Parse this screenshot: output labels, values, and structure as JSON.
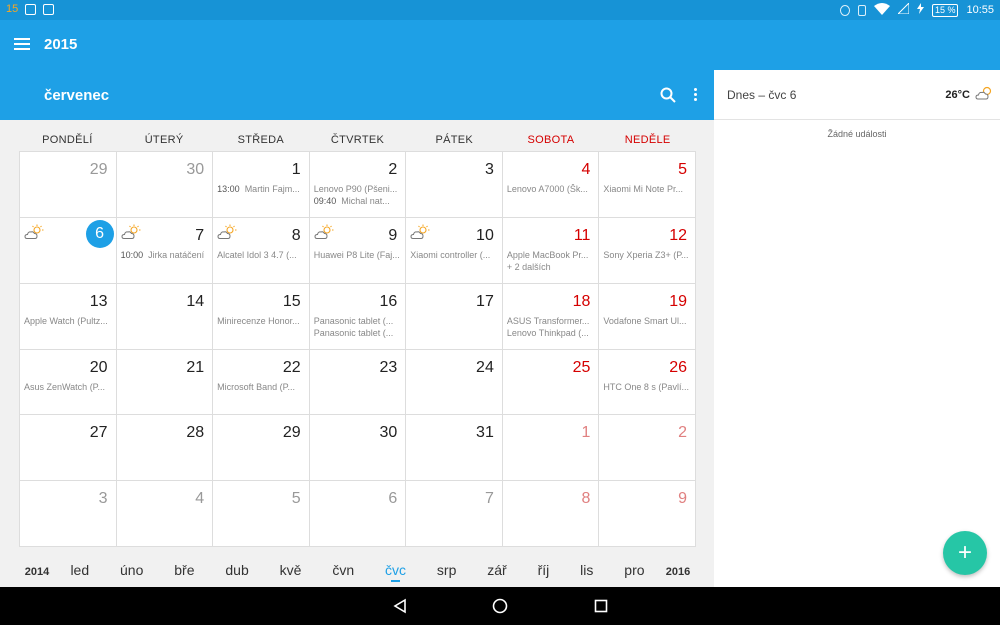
{
  "status_bar": {
    "left_number": "15",
    "battery": "15 %",
    "time": "10:55"
  },
  "app_bar": {
    "year": "2015"
  },
  "sub_bar": {
    "month": "červenec"
  },
  "weekdays": [
    "PONDĚLÍ",
    "ÚTERÝ",
    "STŘEDA",
    "ČTVRTEK",
    "PÁTEK",
    "SOBOTA",
    "NEDĚLE"
  ],
  "weeks": [
    [
      {
        "day": "29",
        "other": true
      },
      {
        "day": "30",
        "other": true
      },
      {
        "day": "1",
        "events": [
          {
            "time": "13:00",
            "title": "Martin Fajm..."
          }
        ]
      },
      {
        "day": "2",
        "events": [
          {
            "time": "",
            "title": "Lenovo P90 (Pšeni..."
          },
          {
            "time": "09:40",
            "title": "Michal nat..."
          }
        ]
      },
      {
        "day": "3"
      },
      {
        "day": "4",
        "events": [
          {
            "time": "",
            "title": "Lenovo A7000 (Šk..."
          }
        ]
      },
      {
        "day": "5",
        "events": [
          {
            "time": "",
            "title": "Xiaomi Mi Note Pr..."
          }
        ]
      }
    ],
    [
      {
        "day": "6",
        "today": true,
        "weather": true
      },
      {
        "day": "7",
        "weather": true,
        "events": [
          {
            "time": "10:00",
            "title": "Jirka natáčení"
          }
        ]
      },
      {
        "day": "8",
        "weather": true,
        "events": [
          {
            "time": "",
            "title": "Alcatel Idol 3 4.7 (..."
          }
        ]
      },
      {
        "day": "9",
        "weather": true,
        "events": [
          {
            "time": "",
            "title": "Huawei P8 Lite (Faj..."
          }
        ]
      },
      {
        "day": "10",
        "weather": true,
        "events": [
          {
            "time": "",
            "title": "Xiaomi controller (..."
          }
        ]
      },
      {
        "day": "11",
        "events": [
          {
            "time": "",
            "title": "Apple MacBook Pr..."
          },
          {
            "time": "",
            "title": "+ 2 dalších"
          }
        ]
      },
      {
        "day": "12",
        "events": [
          {
            "time": "",
            "title": "Sony Xperia Z3+ (P..."
          }
        ]
      }
    ],
    [
      {
        "day": "13",
        "events": [
          {
            "time": "",
            "title": "Apple Watch (Pultz..."
          }
        ]
      },
      {
        "day": "14"
      },
      {
        "day": "15",
        "events": [
          {
            "time": "",
            "title": "Minirecenze Honor..."
          }
        ]
      },
      {
        "day": "16",
        "events": [
          {
            "time": "",
            "title": "Panasonic tablet (..."
          },
          {
            "time": "",
            "title": "Panasonic tablet (..."
          }
        ]
      },
      {
        "day": "17"
      },
      {
        "day": "18",
        "events": [
          {
            "time": "",
            "title": "ASUS Transformer..."
          },
          {
            "time": "",
            "title": "Lenovo Thinkpad (..."
          }
        ]
      },
      {
        "day": "19",
        "events": [
          {
            "time": "",
            "title": "Vodafone Smart Ul..."
          }
        ]
      }
    ],
    [
      {
        "day": "20",
        "events": [
          {
            "time": "",
            "title": "Asus ZenWatch (P..."
          }
        ]
      },
      {
        "day": "21"
      },
      {
        "day": "22",
        "events": [
          {
            "time": "",
            "title": "Microsoft Band (P..."
          }
        ]
      },
      {
        "day": "23"
      },
      {
        "day": "24"
      },
      {
        "day": "25"
      },
      {
        "day": "26",
        "events": [
          {
            "time": "",
            "title": "HTC One 8 s (Pavlí..."
          }
        ]
      }
    ],
    [
      {
        "day": "27"
      },
      {
        "day": "28"
      },
      {
        "day": "29"
      },
      {
        "day": "30"
      },
      {
        "day": "31"
      },
      {
        "day": "1",
        "other": true
      },
      {
        "day": "2",
        "other": true
      }
    ],
    [
      {
        "day": "3",
        "other": true
      },
      {
        "day": "4",
        "other": true
      },
      {
        "day": "5",
        "other": true
      },
      {
        "day": "6",
        "other": true
      },
      {
        "day": "7",
        "other": true
      },
      {
        "day": "8",
        "other": true
      },
      {
        "day": "9",
        "other": true
      }
    ]
  ],
  "month_strip": {
    "prev_year": "2014",
    "next_year": "2016",
    "months": [
      "led",
      "úno",
      "bře",
      "dub",
      "kvě",
      "čvn",
      "čvc",
      "srp",
      "zář",
      "říj",
      "lis",
      "pro"
    ],
    "active_month": "čvc"
  },
  "right_panel": {
    "date": "Dnes – čvc 6",
    "temperature": "26°C",
    "empty_text": "Žádné události"
  },
  "fab_label": "+",
  "colors": {
    "primary": "#1ea0e6",
    "status": "#1793d6",
    "weekend": "#d50000",
    "fab": "#26c6a6"
  }
}
